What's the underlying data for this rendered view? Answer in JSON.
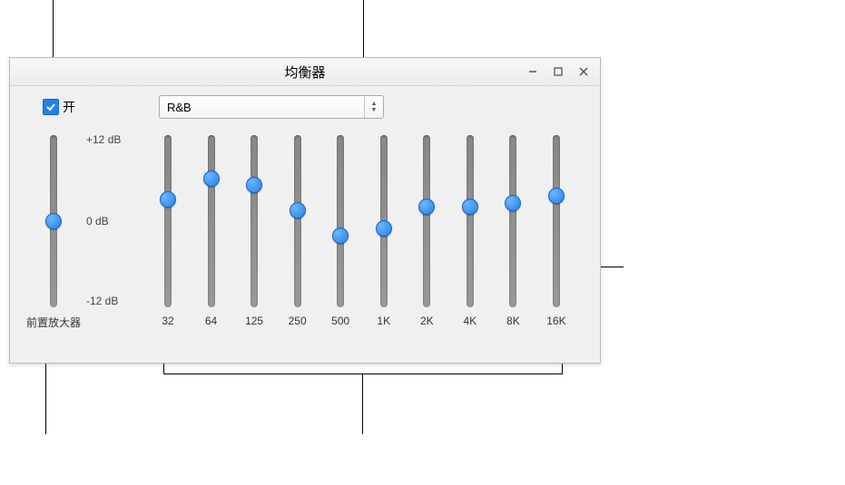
{
  "window": {
    "title": "均衡器"
  },
  "controls": {
    "on_label": "开",
    "on_checked": true,
    "preset": "R&B"
  },
  "preamp": {
    "label": "前置放大器",
    "value_db": 0
  },
  "scale": {
    "max_label": "+12 dB",
    "mid_label": "0 dB",
    "min_label": "-12 dB",
    "max_db": 12,
    "min_db": -12
  },
  "bands": [
    {
      "freq": "32",
      "value_db": 3.0
    },
    {
      "freq": "64",
      "value_db": 6.0
    },
    {
      "freq": "125",
      "value_db": 5.0
    },
    {
      "freq": "250",
      "value_db": 1.5
    },
    {
      "freq": "500",
      "value_db": -2.0
    },
    {
      "freq": "1K",
      "value_db": -1.0
    },
    {
      "freq": "2K",
      "value_db": 2.0
    },
    {
      "freq": "4K",
      "value_db": 2.0
    },
    {
      "freq": "8K",
      "value_db": 2.5
    },
    {
      "freq": "16K",
      "value_db": 3.5
    }
  ],
  "chart_data": {
    "type": "bar",
    "title": "均衡器",
    "ylabel": "dB",
    "ylim": [
      -12,
      12
    ],
    "categories": [
      "32",
      "64",
      "125",
      "250",
      "500",
      "1K",
      "2K",
      "4K",
      "8K",
      "16K"
    ],
    "series": [
      {
        "name": "R&B",
        "values": [
          3.0,
          6.0,
          5.0,
          1.5,
          -2.0,
          -1.0,
          2.0,
          2.0,
          2.5,
          3.5
        ]
      }
    ],
    "preamp_db": 0
  }
}
